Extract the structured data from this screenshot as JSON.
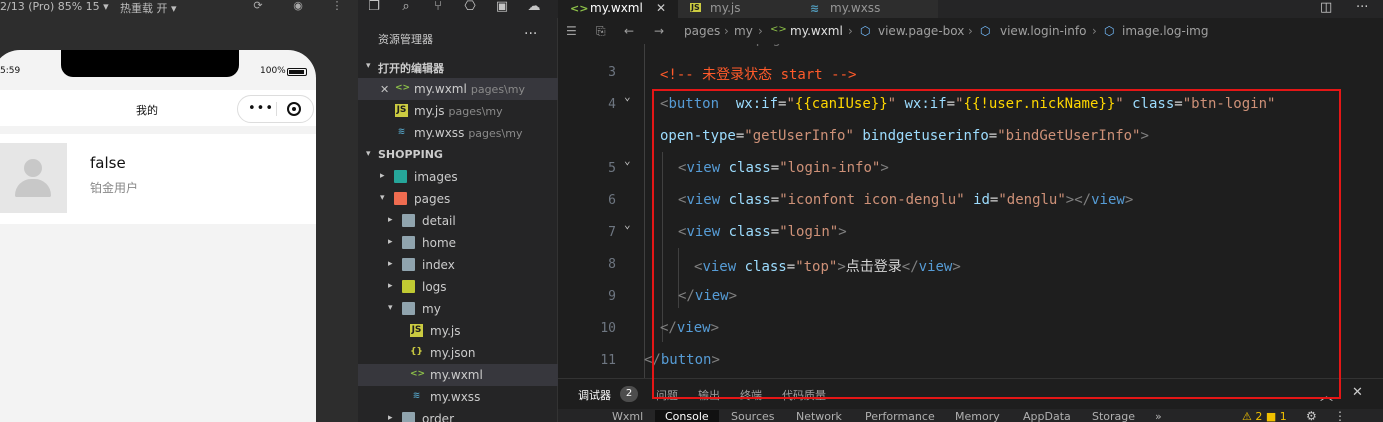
{
  "simulator": {
    "device_label": "2/13 (Pro) 85% 15 ▾",
    "hot_reload_label": "热重载 开 ▾",
    "status_time": "5:59",
    "battery": "100%",
    "nav_title": "我的",
    "capsule_dots": "•••",
    "profile_name": "false",
    "profile_level": "铂金用户"
  },
  "explorer": {
    "title": "资源管理器",
    "more": "···",
    "open_editors_label": "打开的编辑器",
    "open_editors": [
      {
        "name": "my.wxml",
        "path": "pages\\my",
        "icon": "wxml"
      },
      {
        "name": "my.js",
        "path": "pages\\my",
        "icon": "js"
      },
      {
        "name": "my.wxss",
        "path": "pages\\my",
        "icon": "wxss"
      }
    ],
    "project_label": "SHOPPING",
    "tree": [
      {
        "name": "images"
      },
      {
        "name": "pages"
      },
      {
        "name": "detail"
      },
      {
        "name": "home"
      },
      {
        "name": "index"
      },
      {
        "name": "logs"
      },
      {
        "name": "my"
      },
      {
        "name": "my.js"
      },
      {
        "name": "my.json"
      },
      {
        "name": "my.wxml"
      },
      {
        "name": "my.wxss"
      },
      {
        "name": "order"
      }
    ]
  },
  "editor": {
    "tabs": [
      {
        "label": "my.wxml",
        "close": "✕"
      },
      {
        "label": "my.js"
      },
      {
        "label": "my.wxss"
      }
    ],
    "breadcrumb": {
      "pages": "pages",
      "my": "my",
      "file": "my.wxml",
      "c1": "view.page-box",
      "c2": "view.login-info",
      "c3": "image.log-img"
    },
    "code_lines": [
      {
        "n": "3",
        "text": "<!-- 未登录状态 start -->"
      },
      {
        "n": "4",
        "text": "<button  wx:if=\"{{canIUse}}\" wx:if=\"{{!user.nickName}}\" class=\"btn-login\""
      },
      {
        "n": "",
        "text": "open-type=\"getUserInfo\" bindgetuserinfo=\"bindGetUserInfo\">"
      },
      {
        "n": "5",
        "text": "<view class=\"login-info\">"
      },
      {
        "n": "6",
        "text": "<view class=\"iconfont icon-denglu\" id=\"denglu\"></view>"
      },
      {
        "n": "7",
        "text": "<view class=\"login\">"
      },
      {
        "n": "8",
        "text": "<view class=\"top\">点击登录</view>"
      },
      {
        "n": "9",
        "text": "</view>"
      },
      {
        "n": "10",
        "text": "</view>"
      },
      {
        "n": "11",
        "text": "</button>"
      }
    ]
  },
  "panel": {
    "tabs": [
      "调试器",
      "问题",
      "输出",
      "终端",
      "代码质量"
    ],
    "badge": "2",
    "devtools_tabs": [
      "Wxml",
      "Console",
      "Sources",
      "Network",
      "Performance",
      "Memory",
      "AppData",
      "Storage",
      "»"
    ],
    "warn": "⚠ 2 ■ 1"
  },
  "colors": {
    "highlight_box": "#e51616",
    "editor_bg": "#1e1e1e",
    "sidebar_bg": "#252526"
  }
}
